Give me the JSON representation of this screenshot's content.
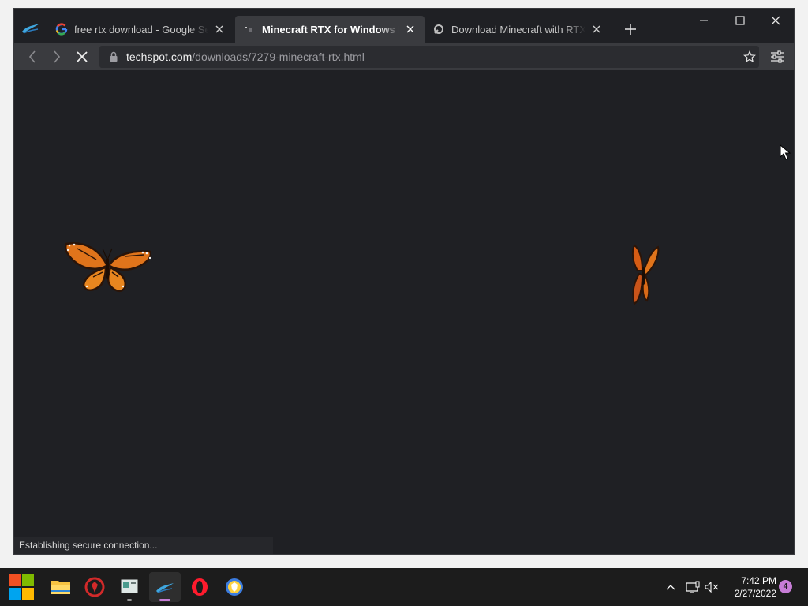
{
  "browser": {
    "tabs": [
      {
        "title": "free rtx download - Google Search",
        "favicon": "google-icon",
        "active": false
      },
      {
        "title": "Minecraft RTX for Windows Download",
        "favicon": "techspot-icon",
        "active": true
      },
      {
        "title": "Download Minecraft with RTX Beta",
        "favicon": "site-icon",
        "active": false
      }
    ],
    "window_controls": [
      "minimize-icon",
      "maximize-icon",
      "close-icon"
    ],
    "url": {
      "host": "techspot.com",
      "path": "/downloads/7279-minecraft-rtx.html"
    },
    "status_text": "Establishing secure connection..."
  },
  "taskbar": {
    "apps": [
      "start-icon",
      "file-explorer-icon",
      "security-app-icon",
      "store-icon",
      "browser-app-icon",
      "opera-icon",
      "brave-icon"
    ],
    "clock": {
      "time": "7:42 PM",
      "date": "2/27/2022"
    },
    "notification_count": "4"
  },
  "colors": {
    "accent": "#c77dd6",
    "page_background": "#1f2024",
    "toolbar": "#3a3b3f"
  }
}
